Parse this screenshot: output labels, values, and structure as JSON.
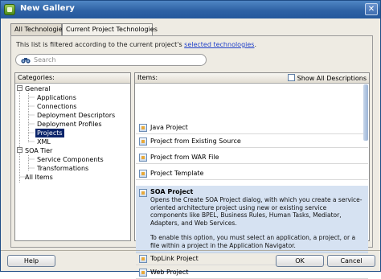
{
  "window": {
    "title": "New Gallery",
    "icon": "gallery-icon",
    "close_glyph": "✕"
  },
  "tabs": [
    {
      "label": "All Technologies",
      "active": true
    },
    {
      "label": "Current Project Technologies",
      "active": false
    }
  ],
  "filter": {
    "text": "This list is filtered according to the current project's ",
    "link": "selected technologies",
    "suffix": "."
  },
  "search": {
    "placeholder": "Search",
    "value": ""
  },
  "categories": {
    "header": "Categories:",
    "tree": [
      {
        "label": "General",
        "expander": "−"
      },
      {
        "label": "Applications"
      },
      {
        "label": "Connections"
      },
      {
        "label": "Deployment Descriptors"
      },
      {
        "label": "Deployment Profiles"
      },
      {
        "label": "Projects",
        "selected": true
      },
      {
        "label": "XML"
      },
      {
        "label": "SOA Tier",
        "expander": "−"
      },
      {
        "label": "Service Components"
      },
      {
        "label": "Transformations"
      },
      {
        "label": "All Items"
      }
    ]
  },
  "items": {
    "header": "Items:",
    "show_all_label": "Show All Descriptions",
    "show_all_checked": false,
    "list": [
      {
        "label": "Java Project"
      },
      {
        "label": "Project from Existing Source"
      },
      {
        "label": "Project from WAR File"
      },
      {
        "label": "Project Template"
      }
    ],
    "selected": {
      "label": "SOA Project",
      "description_1": "Opens the Create SOA Project dialog, with which you create a service-oriented architecture project using new or existing service components like BPEL, Business Rules, Human Tasks, Mediator, Adapters, and Web Services.",
      "description_2": "To enable this option, you must select an application, a project, or a file within a project in the Application Navigator."
    },
    "after": [
      {
        "label": "TopLink Project"
      },
      {
        "label": "Web Project"
      }
    ]
  },
  "buttons": {
    "help": "Help",
    "ok": "OK",
    "cancel": "Cancel"
  },
  "colors": {
    "titlebar": "#2f62a5",
    "selection": "#0a246a",
    "item_highlight": "#d6e2f2",
    "link": "#1f3fc8"
  }
}
